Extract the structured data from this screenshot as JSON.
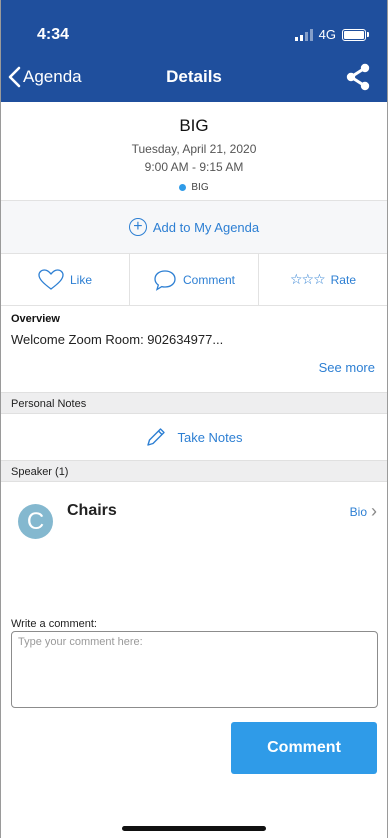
{
  "status_bar": {
    "time": "4:34",
    "network": "4G"
  },
  "nav": {
    "back_label": "Agenda",
    "title": "Details"
  },
  "session": {
    "title": "BIG",
    "date": "Tuesday, April 21, 2020",
    "time": "9:00 AM - 9:15 AM",
    "track": "BIG",
    "track_color": "#2f9be8"
  },
  "add_agenda": {
    "label": "Add to My Agenda"
  },
  "actions": {
    "like": "Like",
    "comment": "Comment",
    "rate": "Rate"
  },
  "overview": {
    "heading": "Overview",
    "text": "Welcome Zoom Room: 902634977...",
    "see_more": "See more"
  },
  "personal_notes": {
    "heading": "Personal Notes",
    "take_notes": "Take Notes"
  },
  "speakers": {
    "heading": "Speaker (1)",
    "items": [
      {
        "initial": "C",
        "name": "Chairs",
        "bio_label": "Bio"
      }
    ]
  },
  "comment_form": {
    "label": "Write a comment:",
    "placeholder": "Type your comment here:",
    "button_label": "Comment"
  },
  "colors": {
    "header": "#1f4f9d",
    "accent": "#2d7fd3",
    "button": "#2f9be8"
  }
}
